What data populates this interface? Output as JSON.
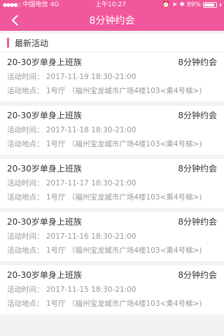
{
  "status_bar": {
    "carrier": "中国电信",
    "network": "4G",
    "time": "上午10:27",
    "battery_percent": "89%",
    "battery_level": 0.89
  },
  "nav": {
    "title": "8分钟约会"
  },
  "section": {
    "title": "最新活动"
  },
  "events": [
    {
      "title": "20-30岁单身上班族",
      "type": "8分钟约会",
      "time": "活动时间： 2017-11-19 18:30-21:00",
      "place": "活动地点： 1号厅 （福州宝龙城市广场4楼103<乘4号梯>)"
    },
    {
      "title": "20-30岁单身上班族",
      "type": "8分钟约会",
      "time": "活动时间： 2017-11-18 18:30-21:00",
      "place": "活动地点： 1号厅 （福州宝龙城市广场4楼103<乘4号梯>)"
    },
    {
      "title": "20-30岁单身上班族",
      "type": "8分钟约会",
      "time": "活动时间： 2017-11-17 18:30-21:00",
      "place": "活动地点： 1号厅 （福州宝龙城市广场4楼103<乘4号梯>)"
    },
    {
      "title": "20-30岁单身上班族",
      "type": "8分钟约会",
      "time": "活动时间： 2017-11-16 18:30-21:00",
      "place": "活动地点： 1号厅 （福州宝龙城市广场4楼103<乘4号梯>)"
    },
    {
      "title": "20-30岁单身上班族",
      "type": "8分钟约会",
      "time": "活动时间： 2017-11-15 18:30-21:00",
      "place": "活动地点： 1号厅 （福州宝龙城市广场4楼103<乘4号梯>)"
    }
  ],
  "colors": {
    "accent": "#f0589b",
    "background": "#f2f2f2",
    "text_primary": "#333333",
    "text_secondary": "#999999"
  },
  "icons": {
    "back": "chevron-left-icon",
    "alarm": "alarm-icon",
    "location": "location-arrow-icon",
    "bluetooth": "bluetooth-icon",
    "battery": "battery-icon"
  }
}
